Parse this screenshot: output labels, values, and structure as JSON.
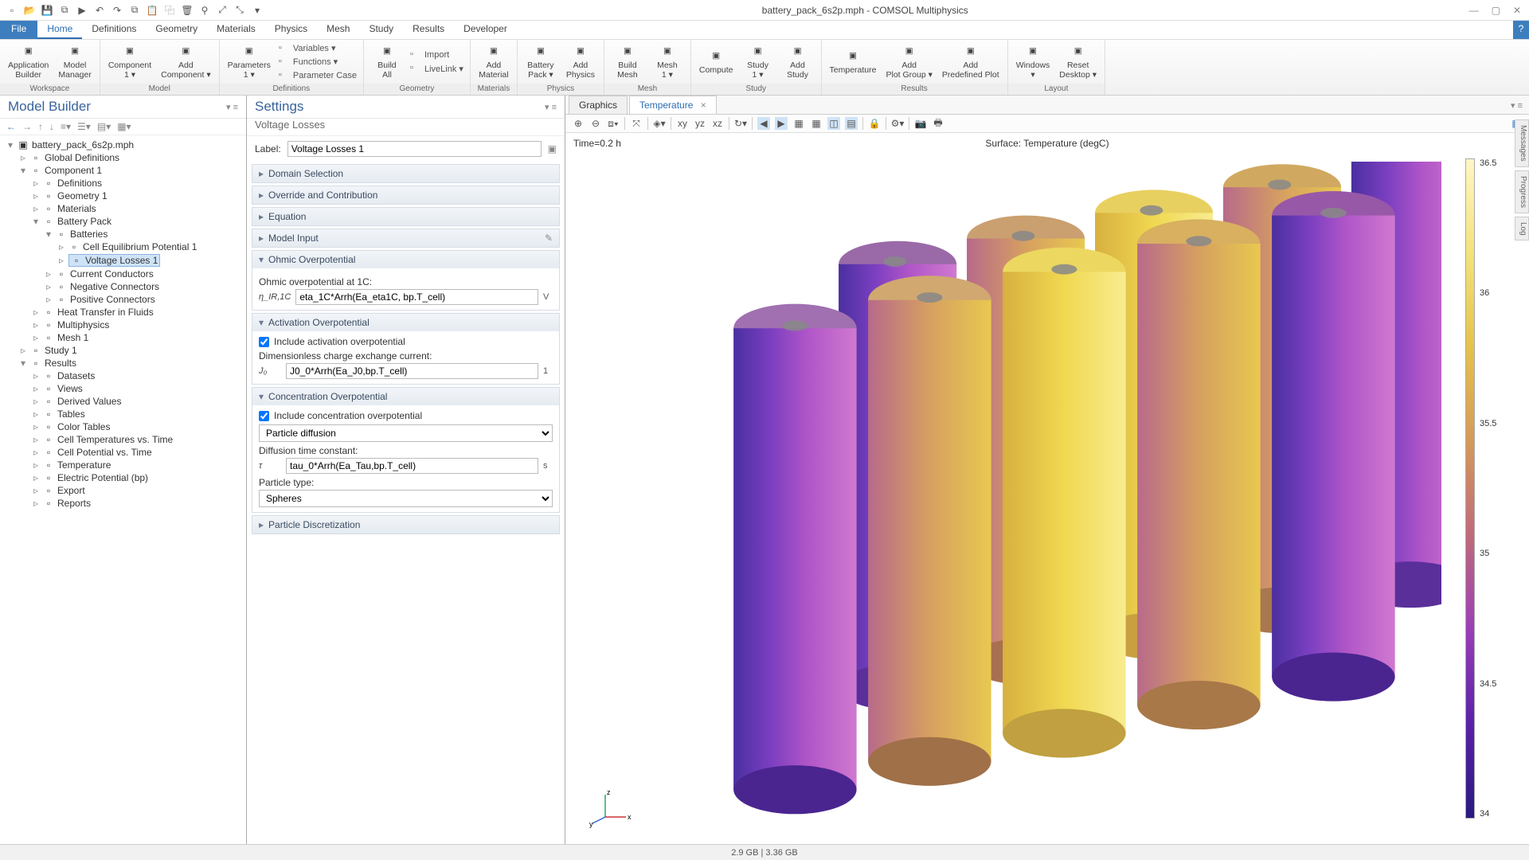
{
  "title": "battery_pack_6s2p.mph - COMSOL Multiphysics",
  "menubar": {
    "file": "File",
    "tabs": [
      "Home",
      "Definitions",
      "Geometry",
      "Materials",
      "Physics",
      "Mesh",
      "Study",
      "Results",
      "Developer"
    ],
    "active": 0
  },
  "ribbon": {
    "groups": [
      {
        "label": "Workspace",
        "items": [
          {
            "name": "Application Builder",
            "icon": "app-builder-icon"
          },
          {
            "name": "Model Manager",
            "icon": "model-manager-icon"
          }
        ]
      },
      {
        "label": "Model",
        "items": [
          {
            "name": "Component 1 ▾",
            "icon": "component-icon"
          },
          {
            "name": "Add Component ▾",
            "icon": "add-component-icon"
          }
        ]
      },
      {
        "label": "Definitions",
        "main": {
          "name": "Parameters 1 ▾",
          "icon": "pi-icon"
        },
        "side": [
          {
            "name": "Variables ▾",
            "icon": "var-icon"
          },
          {
            "name": "Functions ▾",
            "icon": "fn-icon"
          },
          {
            "name": "Parameter Case",
            "icon": "param-case-icon"
          }
        ]
      },
      {
        "label": "Geometry",
        "main": {
          "name": "Build All",
          "icon": "build-icon"
        },
        "side": [
          {
            "name": "Import",
            "icon": "import-icon"
          },
          {
            "name": "LiveLink ▾",
            "icon": "livelink-icon"
          }
        ]
      },
      {
        "label": "Materials",
        "items": [
          {
            "name": "Add Material",
            "icon": "add-material-icon"
          }
        ]
      },
      {
        "label": "Physics",
        "items": [
          {
            "name": "Battery Pack ▾",
            "icon": "battery-icon"
          },
          {
            "name": "Add Physics",
            "icon": "add-physics-icon"
          }
        ]
      },
      {
        "label": "Mesh",
        "items": [
          {
            "name": "Build Mesh",
            "icon": "build-mesh-icon"
          },
          {
            "name": "Mesh 1 ▾",
            "icon": "mesh-icon"
          }
        ]
      },
      {
        "label": "Study",
        "items": [
          {
            "name": "Compute",
            "icon": "compute-icon"
          },
          {
            "name": "Study 1 ▾",
            "icon": "study-icon"
          },
          {
            "name": "Add Study",
            "icon": "add-study-icon"
          }
        ]
      },
      {
        "label": "Results",
        "items": [
          {
            "name": "Temperature",
            "icon": "temp-plot-icon"
          },
          {
            "name": "Add Plot Group ▾",
            "icon": "add-plot-group-icon"
          },
          {
            "name": "Add Predefined Plot",
            "icon": "predef-plot-icon"
          }
        ]
      },
      {
        "label": "Layout",
        "items": [
          {
            "name": "Windows ▾",
            "icon": "windows-icon"
          },
          {
            "name": "Reset Desktop ▾",
            "icon": "reset-icon"
          }
        ]
      }
    ]
  },
  "modelBuilder": {
    "title": "Model Builder",
    "root": "battery_pack_6s2p.mph",
    "tree": [
      {
        "label": "Global Definitions",
        "icon": "globals-icon"
      },
      {
        "label": "Component 1",
        "icon": "component-icon",
        "expanded": true,
        "children": [
          {
            "label": "Definitions",
            "icon": "defs-icon"
          },
          {
            "label": "Geometry 1",
            "icon": "geom-icon"
          },
          {
            "label": "Materials",
            "icon": "materials-icon"
          },
          {
            "label": "Battery Pack",
            "icon": "battery-icon",
            "expanded": true,
            "children": [
              {
                "label": "Batteries",
                "icon": "batteries-icon",
                "expanded": true,
                "children": [
                  {
                    "label": "Cell Equilibrium Potential 1",
                    "icon": "node-icon"
                  },
                  {
                    "label": "Voltage Losses 1",
                    "icon": "node-icon",
                    "selected": true
                  }
                ]
              },
              {
                "label": "Current Conductors",
                "icon": "folder-icon"
              },
              {
                "label": "Negative Connectors",
                "icon": "folder-icon"
              },
              {
                "label": "Positive Connectors",
                "icon": "folder-icon"
              }
            ]
          },
          {
            "label": "Heat Transfer in Fluids",
            "icon": "heat-icon"
          },
          {
            "label": "Multiphysics",
            "icon": "multiphys-icon"
          },
          {
            "label": "Mesh 1",
            "icon": "mesh-icon"
          }
        ]
      },
      {
        "label": "Study 1",
        "icon": "study-icon"
      },
      {
        "label": "Results",
        "icon": "results-icon",
        "expanded": true,
        "children": [
          {
            "label": "Datasets",
            "icon": "datasets-icon"
          },
          {
            "label": "Views",
            "icon": "views-icon"
          },
          {
            "label": "Derived Values",
            "icon": "derived-icon"
          },
          {
            "label": "Tables",
            "icon": "tables-icon"
          },
          {
            "label": "Color Tables",
            "icon": "color-icon"
          },
          {
            "label": "Cell Temperatures vs. Time",
            "icon": "plot-icon"
          },
          {
            "label": "Cell Potential vs. Time",
            "icon": "plot-icon"
          },
          {
            "label": "Temperature",
            "icon": "plot-icon"
          },
          {
            "label": "Electric Potential (bp)",
            "icon": "plot-icon"
          },
          {
            "label": "Export",
            "icon": "export-icon"
          },
          {
            "label": "Reports",
            "icon": "reports-icon"
          }
        ]
      }
    ]
  },
  "settings": {
    "title": "Settings",
    "subtitle": "Voltage Losses",
    "label_field": "Label:",
    "label_value": "Voltage Losses 1",
    "sections": [
      {
        "title": "Domain Selection",
        "open": false
      },
      {
        "title": "Override and Contribution",
        "open": false
      },
      {
        "title": "Equation",
        "open": false
      },
      {
        "title": "Model Input",
        "open": false,
        "edit": true
      },
      {
        "title": "Ohmic Overpotential",
        "open": true,
        "body": {
          "lbl": "Ohmic overpotential at 1C:",
          "sym": "η_IR,1C",
          "val": "eta_1C*Arrh(Ea_eta1C, bp.T_cell)",
          "unit": "V"
        }
      },
      {
        "title": "Activation Overpotential",
        "open": true,
        "body": {
          "chk": "Include activation overpotential",
          "lbl": "Dimensionless charge exchange current:",
          "sym": "J₀",
          "val": "J0_0*Arrh(Ea_J0,bp.T_cell)",
          "unit": "1"
        }
      },
      {
        "title": "Concentration Overpotential",
        "open": true,
        "body": {
          "chk": "Include concentration overpotential",
          "sel1": "Particle diffusion",
          "lbl": "Diffusion time constant:",
          "sym": "τ",
          "val": "tau_0*Arrh(Ea_Tau,bp.T_cell)",
          "unit": "s",
          "lbl2": "Particle type:",
          "sel2": "Spheres"
        }
      },
      {
        "title": "Particle Discretization",
        "open": false
      }
    ]
  },
  "graphics": {
    "tabs": [
      "Graphics",
      "Temperature"
    ],
    "active": 1,
    "time": "Time=0.2 h",
    "surface_title": "Surface: Temperature (degC)",
    "colorbar_ticks": [
      "36.5",
      "36",
      "35.5",
      "35",
      "34.5",
      "34"
    ],
    "axes": {
      "x": "x",
      "y": "y",
      "z": "z"
    }
  },
  "side_tabs": [
    "Messages",
    "Progress",
    "Log"
  ],
  "status": "2.9 GB | 3.36 GB"
}
